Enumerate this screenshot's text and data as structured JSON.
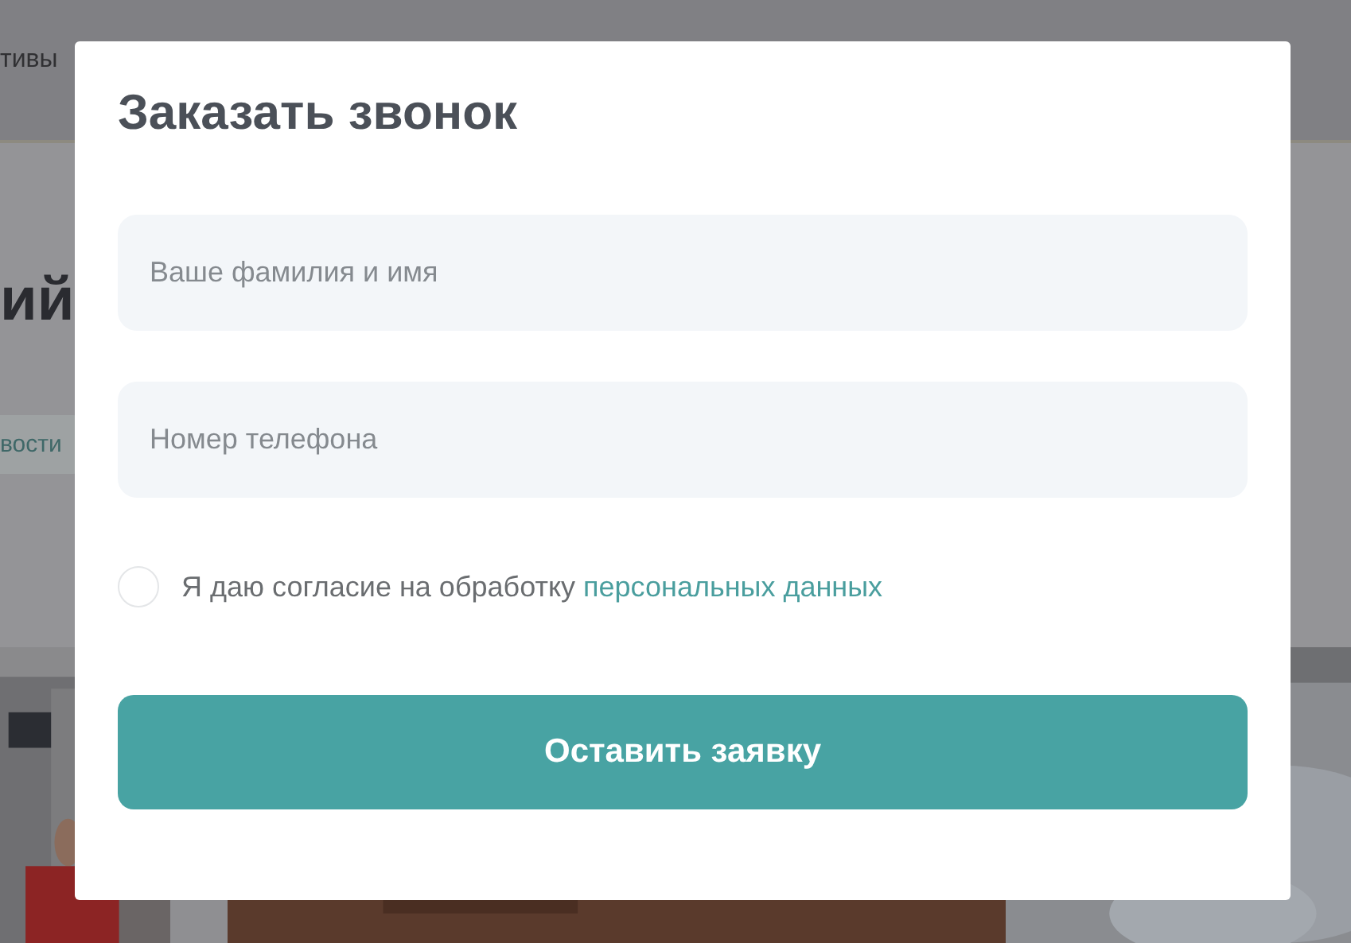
{
  "background_page": {
    "nav_text": "тивы",
    "heading": "ий",
    "tab_label": "вости"
  },
  "modal": {
    "title": "Заказать звонок",
    "fields": [
      {
        "placeholder": "Ваше фамилия и имя"
      },
      {
        "placeholder": "Номер телефона"
      }
    ],
    "consent": {
      "checked": false,
      "text": "Я даю согласие на обработку",
      "link": "персональных данных"
    },
    "submit_button": "Оставить заявку"
  }
}
